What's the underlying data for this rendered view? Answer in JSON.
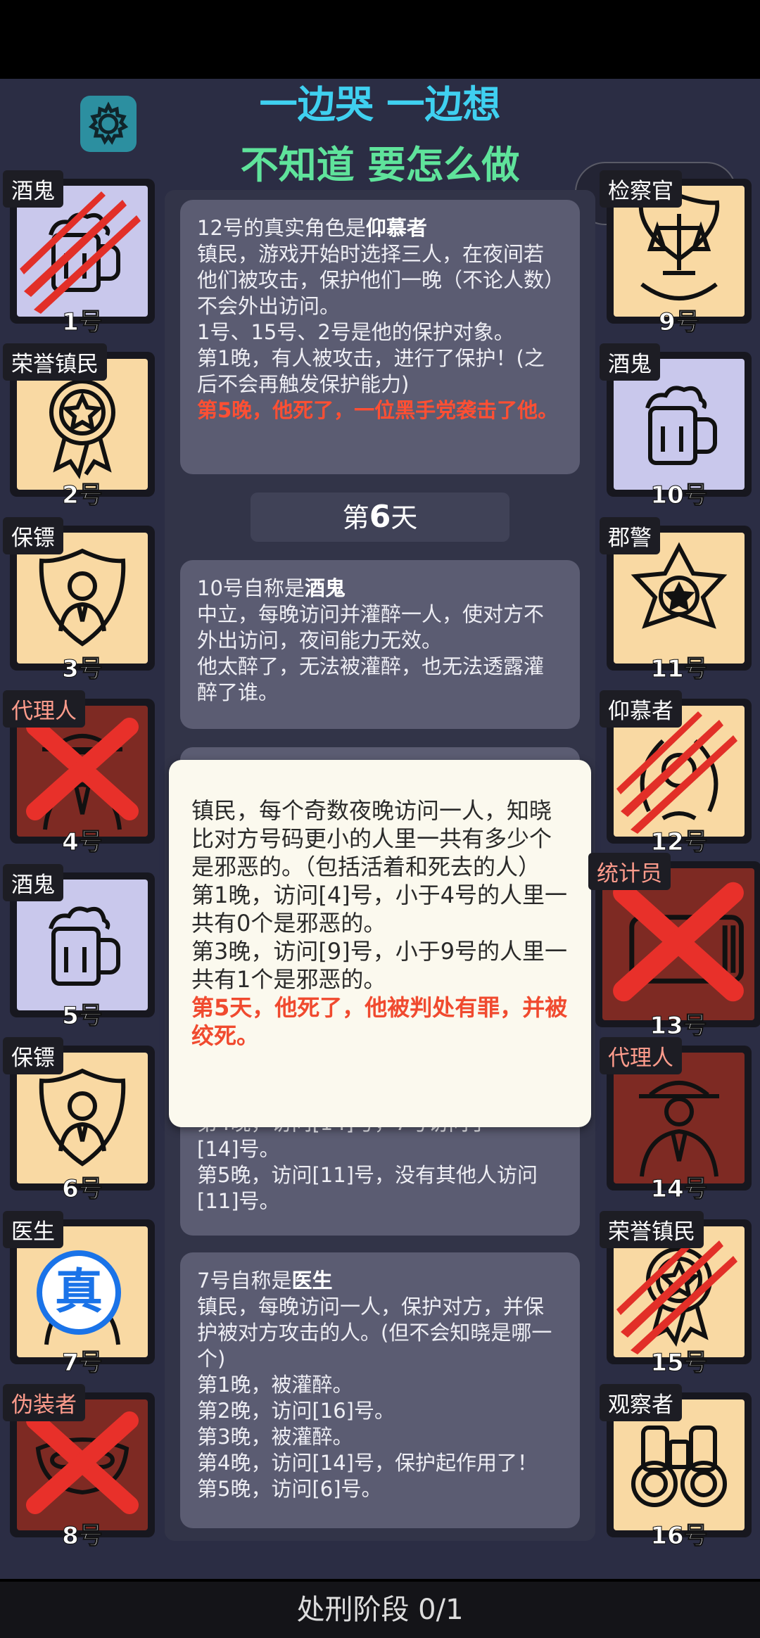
{
  "header": {
    "banner_line1": "一边哭 一边想",
    "banner_line2": "不知道 要怎么做"
  },
  "players": [
    {
      "num": "1号",
      "role": "酒鬼",
      "status": "slashed",
      "icon": "beer-mug-icon"
    },
    {
      "num": "2号",
      "role": "荣誉镇民",
      "status": "alive",
      "icon": "medal-icon"
    },
    {
      "num": "3号",
      "role": "保镖",
      "status": "alive",
      "icon": "shield-person-icon"
    },
    {
      "num": "4号",
      "role": "代理人",
      "status": "crossed",
      "icon": "agent-icon"
    },
    {
      "num": "5号",
      "role": "酒鬼",
      "status": "alive",
      "icon": "beer-mug-icon"
    },
    {
      "num": "6号",
      "role": "保镖",
      "status": "alive",
      "icon": "shield-person-icon"
    },
    {
      "num": "7号",
      "role": "医生",
      "status": "alive",
      "icon": "doctor-icon",
      "stamp": "真"
    },
    {
      "num": "8号",
      "role": "伪装者",
      "status": "crossed",
      "icon": "mask-icon"
    },
    {
      "num": "9号",
      "role": "检察官",
      "status": "alive",
      "icon": "scales-icon"
    },
    {
      "num": "10号",
      "role": "酒鬼",
      "status": "alive",
      "icon": "beer-mug-icon"
    },
    {
      "num": "11号",
      "role": "郡警",
      "status": "alive",
      "icon": "sheriff-star-icon"
    },
    {
      "num": "12号",
      "role": "仰慕者",
      "status": "slashed",
      "icon": "laurel-icon"
    },
    {
      "num": "13号",
      "role": "统计员",
      "status": "crossed",
      "icon": "calculator-icon"
    },
    {
      "num": "14号",
      "role": "代理人",
      "status": "alive",
      "icon": "agent-icon"
    },
    {
      "num": "15号",
      "role": "荣誉镇民",
      "status": "slashed",
      "icon": "medal-icon"
    },
    {
      "num": "16号",
      "role": "观察者",
      "status": "alive",
      "icon": "binoculars-icon"
    }
  ],
  "log": {
    "card1": {
      "prefix": "12号的真实角色是",
      "role": "仰慕者",
      "lines": [
        "镇民，游戏开始时选择三人，在夜间若他们被攻击，保护他们一晚（不论人数）不会外出访问。",
        "1号、15号、2号是他的保护对象。",
        "第1晚，有人被攻击，进行了保护！(之后不会再触发保护能力)"
      ],
      "red": "第5晚，他死了，一位黑手党袭击了他。"
    },
    "day_prefix": "第",
    "day_num": "6",
    "day_suffix": "天",
    "card2": {
      "prefix": "10号自称是",
      "role": "酒鬼",
      "lines": [
        "中立，每晚访问并灌醉一人，使对方不外出访问，夜间能力无效。",
        "他太醉了，无法被灌醉，也无法透露灌醉了谁。"
      ]
    },
    "card3": {
      "partial": "第4晚，访问[14]号，7号访问了",
      "lines": [
        "[14]号。",
        "第5晚，访问[11]号，没有其他人访问[11]号。"
      ]
    },
    "card4": {
      "prefix": "7号自称是",
      "role": "医生",
      "lines": [
        "镇民，每晚访问一人，保护对方，并保护被对方攻击的人。(但不会知晓是哪一个)",
        "第1晚，被灌醉。",
        "第2晚，访问[16]号。",
        "第3晚，被灌醉。",
        "第4晚，访问[14]号，保护起作用了！",
        "第5晚，访问[6]号。"
      ]
    }
  },
  "popup": {
    "lines": [
      "镇民，每个奇数夜晚访问一人，知晓比对方号码更小的人里一共有多少个是邪恶的。（包括活着和死去的人）",
      "第1晚，访问[4]号，小于4号的人里一共有0个是邪恶的。",
      "第3晚，访问[9]号，小于9号的人里一共有1个是邪恶的。"
    ],
    "red": "第5天，他死了，他被判处有罪，并被绞死。"
  },
  "footer": {
    "label": "处刑阶段 0/1"
  },
  "colors": {
    "alive_bg": "#f9d9a3",
    "drunk_bg": "#c9c8ec",
    "evil_bg": "#7e2a23",
    "cross": "#e8302a",
    "accent_cyan": "#3fd0f0",
    "accent_green": "#5fe39b"
  }
}
